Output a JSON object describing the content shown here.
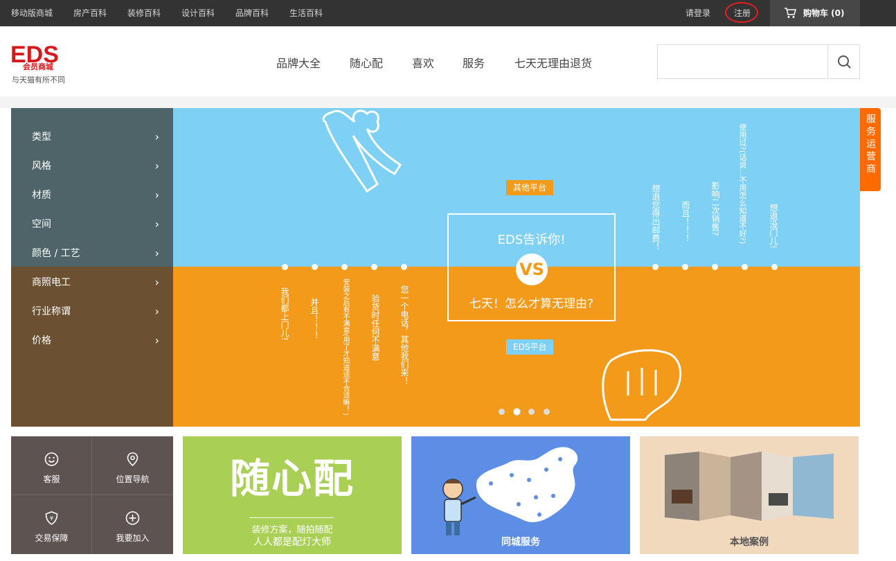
{
  "topbar": {
    "links": [
      "移动版商城",
      "房产百科",
      "装修百科",
      "设计百科",
      "品牌百科",
      "生活百科"
    ],
    "login": "请登录",
    "register": "注册",
    "cart": "购物车 (0)"
  },
  "header": {
    "logo_text": "EDS",
    "logo_sub": "会员商城",
    "slogan": "与天猫有所不同",
    "nav": [
      "品牌大全",
      "随心配",
      "喜欢",
      "服务",
      "七天无理由退货"
    ],
    "search_placeholder": ""
  },
  "sidebar": {
    "items": [
      {
        "label": "类型"
      },
      {
        "label": "风格"
      },
      {
        "label": "材质"
      },
      {
        "label": "空间"
      },
      {
        "label": "颜色 / 工艺"
      },
      {
        "label": "商照电工"
      },
      {
        "label": "行业称谓"
      },
      {
        "label": "价格"
      }
    ]
  },
  "service_tab": "服务运营商",
  "banner": {
    "tag_top": "其他平台",
    "tag_bottom": "EDS平台",
    "box_title": "EDS告诉你!",
    "vs": "VS",
    "box_sub": "七天！怎么才算无理由?",
    "top_texts": [
      "想退您得出邮费！",
      "而且！！！",
      "影响二次销售?",
      "使用过?(话说…不用怎么知道不好?)",
      "想退没门儿!"
    ],
    "bottom_texts": [
      "我们都上门儿!",
      "并且！！！",
      "安装之后有不满意(用了才知道适不合适嘛！)",
      "验货时任何不满意",
      "您一个电话，其他我们来！"
    ],
    "pager_active": 2,
    "pager_count": 4
  },
  "quick": [
    {
      "icon": "smile-icon",
      "label": "客服"
    },
    {
      "icon": "location-icon",
      "label": "位置导航"
    },
    {
      "icon": "shield-icon",
      "label": "交易保障"
    },
    {
      "icon": "plus-circle-icon",
      "label": "我要加入"
    }
  ],
  "cards": {
    "suixinpei": {
      "title": "随心配",
      "line1": "装修方案，随拍随配",
      "line2": "人人都是配灯大师"
    },
    "city": {
      "caption": "同城服务"
    },
    "local": {
      "caption": "本地案例"
    }
  },
  "colors": {
    "topbar": "#333333",
    "sky": "#7ed0f5",
    "orange": "#f39a1b",
    "accent": "#ff6a00",
    "brand_red": "#e02020"
  }
}
